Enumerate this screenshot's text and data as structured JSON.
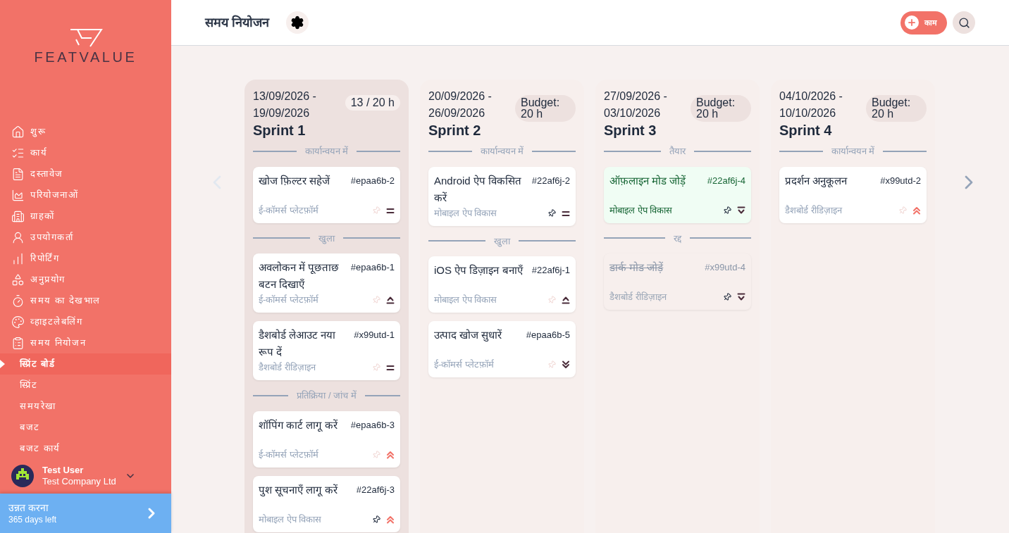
{
  "sidebar": {
    "logo": "FEATVALUE",
    "nav": [
      {
        "label": "शुरू",
        "selected": false
      },
      {
        "label": "कार्य",
        "selected": false
      },
      {
        "label": "दस्तावेज",
        "selected": false
      },
      {
        "label": "परियोजनाओं",
        "selected": false
      },
      {
        "label": "ग्राहकों",
        "selected": false
      },
      {
        "label": "उपयोगकर्ता",
        "selected": false
      },
      {
        "label": "रिपोर्टिंग",
        "selected": false
      },
      {
        "label": "अनुप्रयोग",
        "selected": false
      },
      {
        "label": "समय का देखभाल",
        "selected": false
      },
      {
        "label": "व्हाइटलेबलिंग",
        "selected": false
      },
      {
        "label": "समय नियोजन",
        "selected": false
      }
    ],
    "subnav": [
      {
        "label": "स्प्रिंट बोर्ड",
        "selected": true
      },
      {
        "label": "स्प्रिंट",
        "selected": false
      },
      {
        "label": "समयरेखा",
        "selected": false
      },
      {
        "label": "बजट",
        "selected": false
      },
      {
        "label": "बजट कार्य",
        "selected": false
      }
    ],
    "user": {
      "name": "Test User",
      "company": "Test Company Ltd"
    },
    "upgrade": {
      "title": "उन्नत करना",
      "subtitle": "365 days left"
    }
  },
  "header": {
    "title": "समय नियोजन",
    "add_button": "काम"
  },
  "sprints": [
    {
      "dates": "13/09/2026 - 19/09/2026",
      "budget": "13 / 20 h",
      "name": "Sprint 1",
      "selected": true,
      "groups": [
        {
          "status": "कार्यान्वयन में",
          "cards": [
            {
              "kind": "normal",
              "title": "खोज फ़िल्टर सहेजें",
              "id": "#epaa6b-2",
              "project": "ई-कॉमर्स प्लेटफ़ॉर्म",
              "pinned": false,
              "priority": {
                "kind": "medium"
              }
            }
          ]
        },
        {
          "status": "खुला",
          "cards": [
            {
              "kind": "normal",
              "title": "अवलोकन में पूछताछ बटन दिखाएँ",
              "id": "#epaa6b-1",
              "project": "ई-कॉमर्स प्लेटफ़ॉर्म",
              "pinned": false,
              "priority": {
                "kind": "high"
              }
            },
            {
              "kind": "normal",
              "title": "डैशबोर्ड लेआउट नया रूप दें",
              "id": "#x99utd-1",
              "project": "डैशबोर्ड रीडिज़ाइन",
              "pinned": false,
              "priority": {
                "kind": "medium"
              }
            }
          ]
        },
        {
          "status": "प्रतिक्रिया / जांच में",
          "cards": [
            {
              "kind": "normal",
              "title": "शॉपिंग कार्ट लागू करें",
              "id": "#epaa6b-3",
              "project": "ई-कॉमर्स प्लेटफ़ॉर्म",
              "pinned": false,
              "priority": {
                "kind": "highest"
              }
            },
            {
              "kind": "normal",
              "title": "पुश सूचनाएँ लागू करें",
              "id": "#22af6j-3",
              "project": "मोबाइल ऐप विकास",
              "pinned": true,
              "priority": {
                "kind": "highest"
              }
            }
          ]
        }
      ]
    },
    {
      "dates": "20/09/2026 - 26/09/2026",
      "budget": "Budget: 20 h",
      "name": "Sprint 2",
      "selected": false,
      "groups": [
        {
          "status": "कार्यान्वयन में",
          "cards": [
            {
              "kind": "normal",
              "title": "Android ऐप विकसित करें",
              "id": "#22af6j-2",
              "project": "मोबाइल ऐप विकास",
              "pinned": true,
              "priority": {
                "kind": "medium"
              }
            }
          ]
        },
        {
          "status": "खुला",
          "cards": [
            {
              "kind": "normal",
              "title": "iOS ऐप डिज़ाइन बनाएँ",
              "id": "#22af6j-1",
              "project": "मोबाइल ऐप विकास",
              "pinned": false,
              "priority": {
                "kind": "high"
              }
            },
            {
              "kind": "normal",
              "title": "उत्पाद खोज सुधारें",
              "id": "#epaa6b-5",
              "project": "ई-कॉमर्स प्लेटफ़ॉर्म",
              "pinned": false,
              "priority": {
                "kind": "lowest"
              }
            }
          ]
        }
      ]
    },
    {
      "dates": "27/09/2026 - 03/10/2026",
      "budget": "Budget: 20 h",
      "name": "Sprint 3",
      "selected": false,
      "groups": [
        {
          "status": "तैयार",
          "cards": [
            {
              "kind": "done",
              "title": "ऑफ़लाइन मोड जोड़ें",
              "id": "#22af6j-4",
              "project": "मोबाइल ऐप विकास",
              "pinned": true,
              "priority": {
                "kind": "low"
              }
            }
          ]
        },
        {
          "status": "रद्द",
          "cards": [
            {
              "kind": "cancelled",
              "title": "डार्क मोड जोड़ें",
              "id": "#x99utd-4",
              "project": "डैशबोर्ड रीडिज़ाइन",
              "pinned": true,
              "priority": {
                "kind": "low"
              }
            }
          ]
        }
      ]
    },
    {
      "dates": "04/10/2026 - 10/10/2026",
      "budget": "Budget: 20 h",
      "name": "Sprint 4",
      "selected": false,
      "groups": [
        {
          "status": "कार्यान्वयन में",
          "cards": [
            {
              "kind": "normal",
              "title": "प्रदर्शन अनुकूलन",
              "id": "#x99utd-2",
              "project": "डैशबोर्ड रीडिज़ाइन",
              "pinned": false,
              "priority": {
                "kind": "highest"
              }
            }
          ]
        }
      ]
    }
  ]
}
